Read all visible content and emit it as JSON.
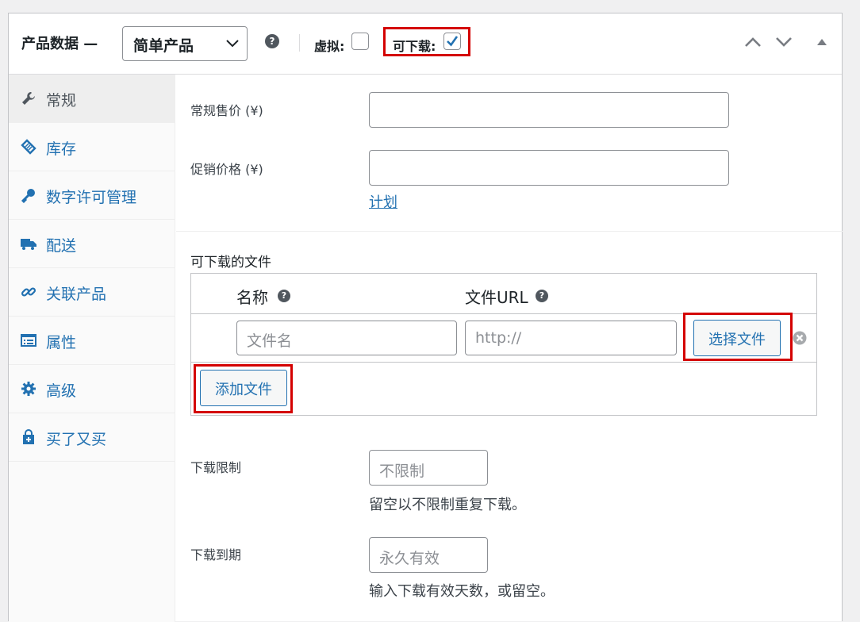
{
  "header": {
    "title": "产品数据 —",
    "product_type": "简单产品",
    "help": "?",
    "virtual_label": "虚拟:",
    "virtual_checked": false,
    "downloadable_label": "可下载:",
    "downloadable_checked": true
  },
  "sidebar": {
    "items": [
      {
        "label": "常规",
        "icon": "wrench-icon",
        "active": true
      },
      {
        "label": "库存",
        "icon": "tag-icon",
        "active": false
      },
      {
        "label": "数字许可管理",
        "icon": "key-icon",
        "active": false
      },
      {
        "label": "配送",
        "icon": "truck-icon",
        "active": false
      },
      {
        "label": "关联产品",
        "icon": "link-icon",
        "active": false
      },
      {
        "label": "属性",
        "icon": "list-icon",
        "active": false
      },
      {
        "label": "高级",
        "icon": "gear-icon",
        "active": false
      },
      {
        "label": "买了又买",
        "icon": "bag-icon",
        "active": false
      }
    ]
  },
  "pricing": {
    "regular_label": "常规售价 (¥)",
    "regular_value": "",
    "sale_label": "促销价格 (¥)",
    "sale_value": "",
    "schedule_link": "计划"
  },
  "downloads": {
    "title": "可下载的文件",
    "col_name": "名称",
    "col_url": "文件URL",
    "name_placeholder": "文件名",
    "url_placeholder": "http://",
    "choose_button": "选择文件",
    "add_button": "添加文件"
  },
  "limits": {
    "limit_label": "下载限制",
    "limit_placeholder": "不限制",
    "limit_desc": "留空以不限制重复下载。",
    "expiry_label": "下载到期",
    "expiry_placeholder": "永久有效",
    "expiry_desc": "输入下载有效天数，或留空。"
  },
  "colors": {
    "accent": "#2271b1",
    "highlight": "#d40000"
  }
}
